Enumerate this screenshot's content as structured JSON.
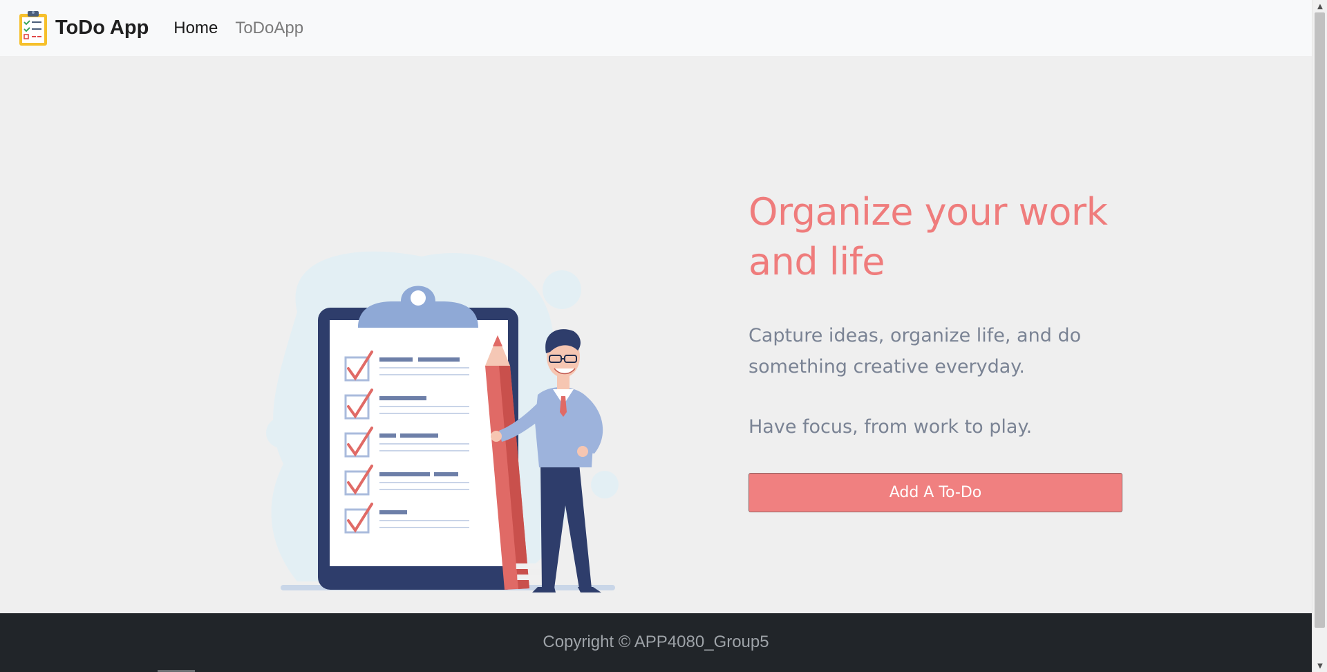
{
  "navbar": {
    "brand": "ToDo App",
    "logo_icon": "clipboard-checklist-icon",
    "links": [
      {
        "label": "Home",
        "active": true
      },
      {
        "label": "ToDoApp",
        "active": false
      }
    ]
  },
  "hero": {
    "headline": "Organize your work and life",
    "subtext": "Capture ideas, organize life, and do something creative everyday.",
    "subtext2": "Have focus, from work to play.",
    "cta_label": "Add A To-Do",
    "illustration_icon": "man-with-pencil-and-checklist-illustration"
  },
  "footer": {
    "copyright": "Copyright © APP4080_Group5"
  },
  "colors": {
    "accent": "#f08080",
    "headline": "#ef7c7c",
    "subtext": "#7a8394",
    "navbar_bg": "#f8f9fa",
    "page_bg": "#efefef",
    "footer_bg": "#212529"
  }
}
